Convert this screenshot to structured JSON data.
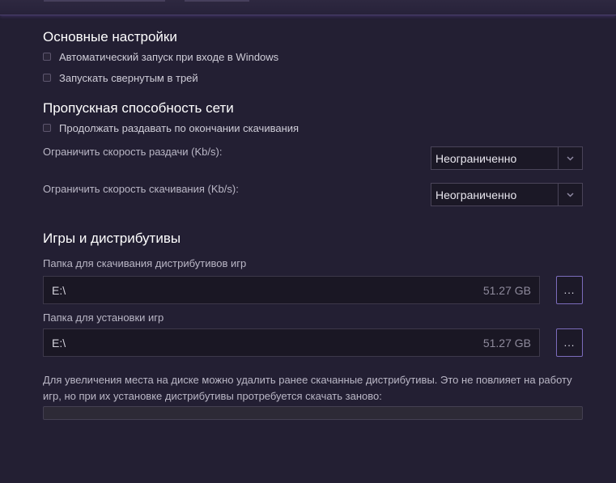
{
  "basic": {
    "title": "Основные настройки",
    "autostart_label": "Автоматический запуск при входе в Windows",
    "start_minimized_label": "Запускать свернутым в трей"
  },
  "network": {
    "title": "Пропускная способность сети",
    "seed_after_label": "Продолжать раздавать по окончании скачивания",
    "upload_limit_label": "Ограничить скорость раздачи (Kb/s):",
    "upload_limit_value": "Неограниченно",
    "download_limit_label": "Ограничить скорость скачивания (Kb/s):",
    "download_limit_value": "Неограниченно"
  },
  "games": {
    "title": "Игры и дистрибутивы",
    "download_folder_label": "Папка для скачивания дистрибутивов игр",
    "download_folder_path": "E:\\",
    "download_folder_free": "51.27 GB",
    "install_folder_label": "Папка для установки игр",
    "install_folder_path": "E:\\",
    "install_folder_free": "51.27 GB",
    "browse_label": "...",
    "note": "Для увеличения места на диске можно удалить ранее скачанные дистрибутивы. Это не повлияет на работу игр, но при их установке дистрибутивы протребуется скачать заново:",
    "progress_fraction": 0
  },
  "colors": {
    "accent": "#7c6cbc",
    "background": "#231f33"
  }
}
